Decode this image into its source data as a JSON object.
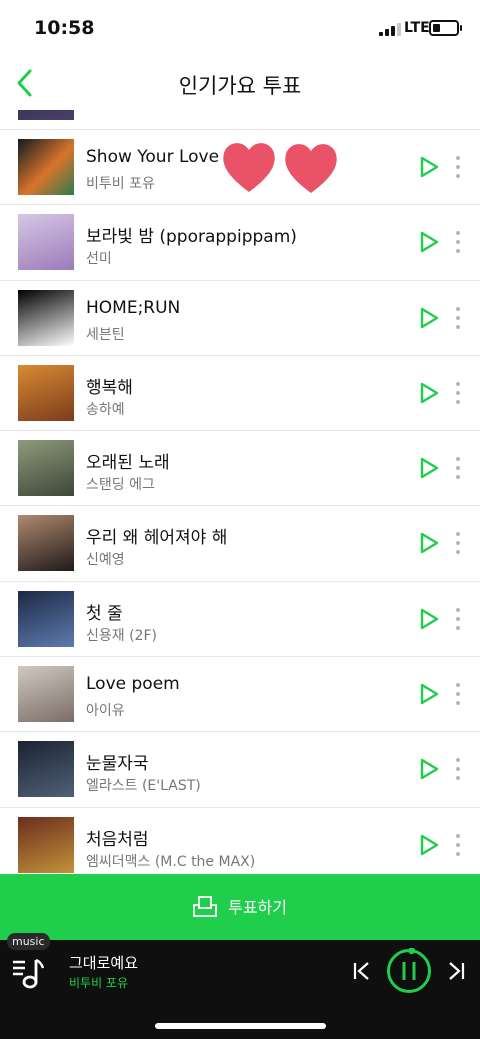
{
  "status_bar": {
    "time": "10:58",
    "network": "LTE",
    "battery_level": 0.3
  },
  "nav": {
    "title": "인기가요 투표",
    "back_icon": "chevron-left-icon"
  },
  "songs": [
    {
      "title": "",
      "artist": "",
      "art_colors": [
        "#2b2740",
        "#4a3f6b"
      ]
    },
    {
      "title": "Show Your Love",
      "artist": "비투비 포유",
      "art_colors": [
        "#0f1b22",
        "#d9742b",
        "#2f7a4e"
      ]
    },
    {
      "title": "보라빛 밤 (pporappippam)",
      "artist": "선미",
      "art_colors": [
        "#d7c7e6",
        "#9a7bb8"
      ]
    },
    {
      "title": "HOME;RUN",
      "artist": "세븐틴",
      "art_colors": [
        "#000000",
        "#ffffff"
      ]
    },
    {
      "title": "행복해",
      "artist": "송하예",
      "art_colors": [
        "#d98a33",
        "#7a3c1c"
      ]
    },
    {
      "title": "오래된 노래",
      "artist": "스탠딩 에그",
      "art_colors": [
        "#8f9a7a",
        "#3e4638"
      ]
    },
    {
      "title": "우리 왜 헤어져야 해",
      "artist": "신예영",
      "art_colors": [
        "#b08a6e",
        "#1e1a1a"
      ]
    },
    {
      "title": "첫 줄",
      "artist": "신용재 (2F)",
      "art_colors": [
        "#1d2a44",
        "#5d7bb0"
      ]
    },
    {
      "title": "Love poem",
      "artist": "아이유",
      "art_colors": [
        "#cfc9c2",
        "#7b6d66"
      ]
    },
    {
      "title": "눈물자국",
      "artist": "엘라스트 (E'LAST)",
      "art_colors": [
        "#1b2330",
        "#516078"
      ]
    },
    {
      "title": "처음처럼",
      "artist": "엠씨더맥스 (M.C the MAX)",
      "art_colors": [
        "#6b2d1e",
        "#c2933a"
      ]
    }
  ],
  "vote": {
    "label": "투표하기",
    "icon": "ballot-box-icon"
  },
  "player": {
    "tag": "music",
    "title": "그대로예요",
    "artist": "비투비 포유",
    "state": "playing",
    "progress": 0.02
  },
  "colors": {
    "accent": "#1fce4b",
    "heart": "#ea5268",
    "player_bg": "#0f0f0f"
  }
}
